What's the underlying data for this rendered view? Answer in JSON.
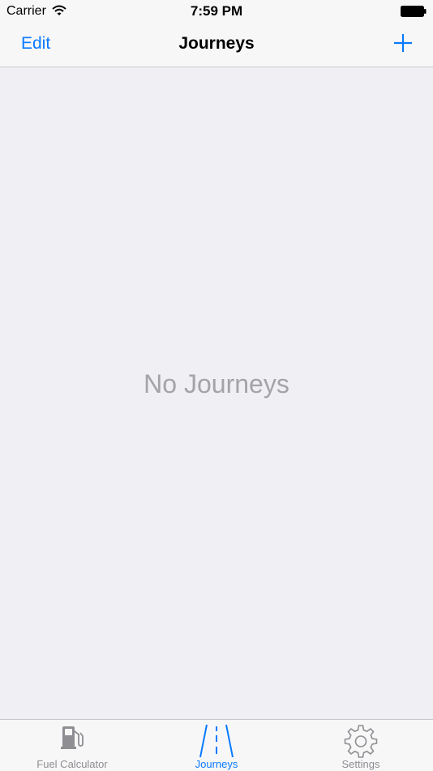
{
  "status_bar": {
    "carrier": "Carrier",
    "time": "7:59 PM",
    "wifi_icon": "wifi-icon",
    "battery_icon": "battery-icon"
  },
  "nav_bar": {
    "edit_label": "Edit",
    "title": "Journeys",
    "add_icon": "plus-icon"
  },
  "content": {
    "empty_message": "No Journeys"
  },
  "tab_bar": {
    "tabs": [
      {
        "label": "Fuel Calculator",
        "icon": "fuel-pump-icon",
        "active": false
      },
      {
        "label": "Journeys",
        "icon": "road-icon",
        "active": true
      },
      {
        "label": "Settings",
        "icon": "gear-icon",
        "active": false
      }
    ]
  },
  "colors": {
    "accent": "#0a7aff",
    "background": "#efeff4",
    "bar_background": "#f7f7f7",
    "inactive_tab": "#8e8e93",
    "empty_text": "#a3a3a8"
  }
}
